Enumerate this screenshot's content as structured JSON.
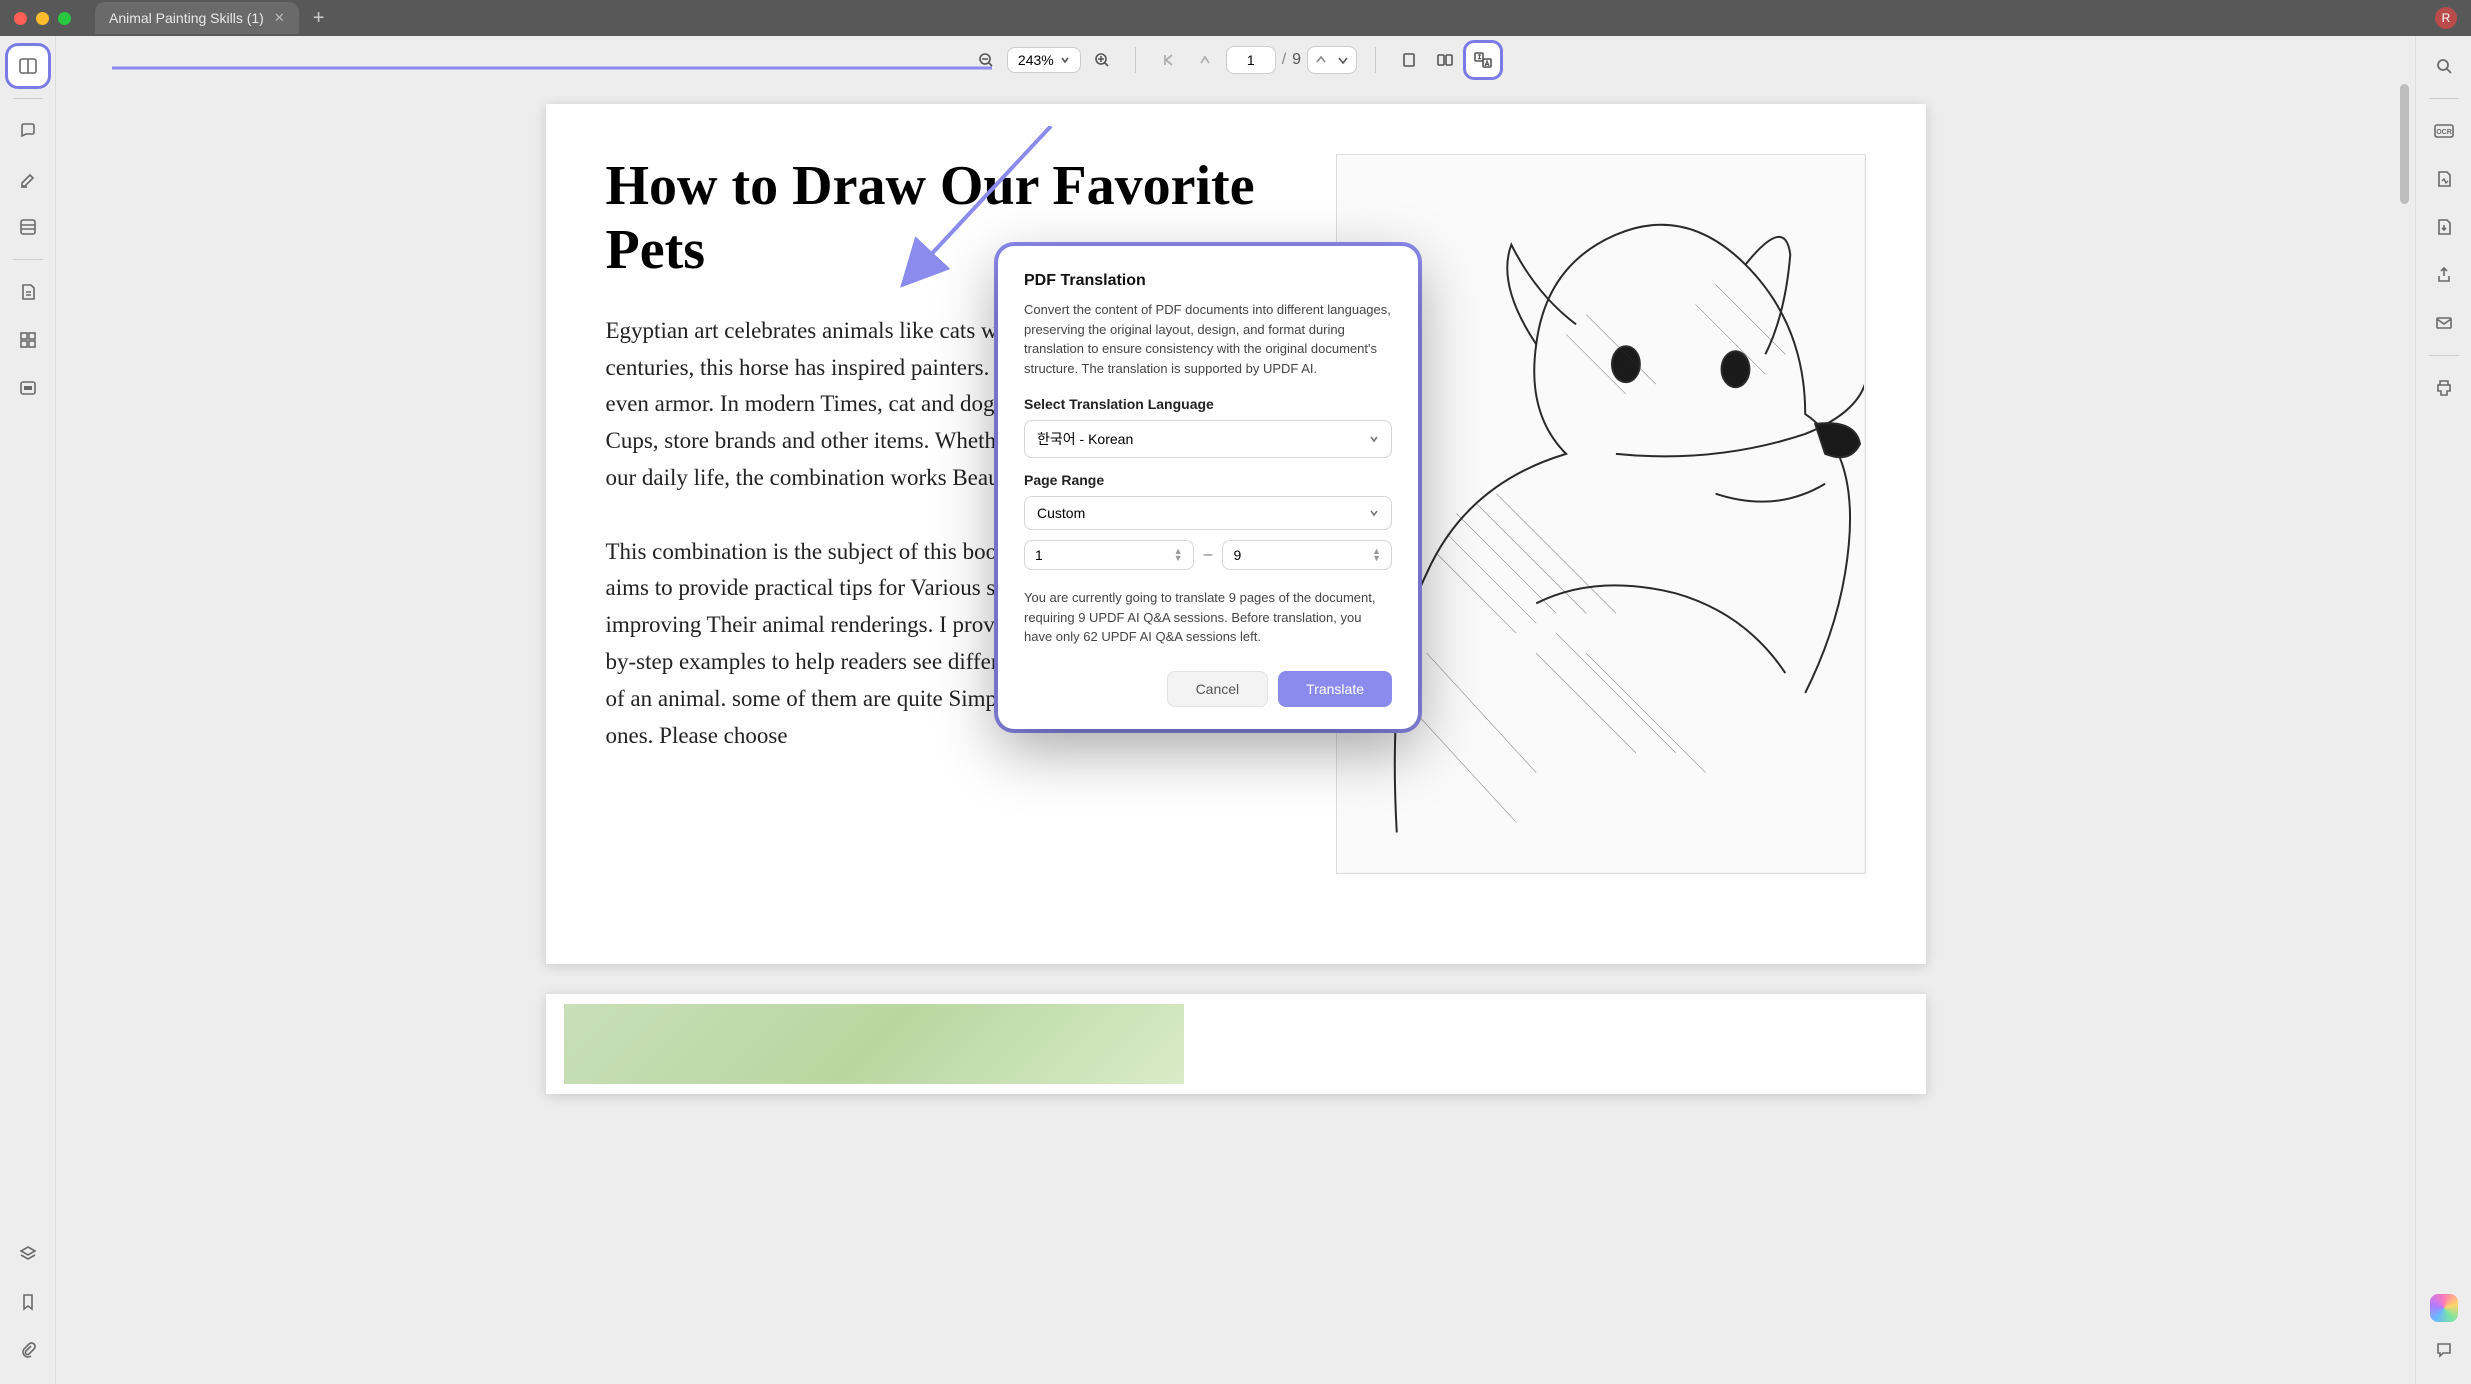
{
  "titlebar": {
    "traffic": [
      "#ff5f57",
      "#febc2e",
      "#28c840"
    ],
    "tab_title": "Animal Painting Skills (1)",
    "avatar_letter": "R"
  },
  "toolbar": {
    "zoom": "243%",
    "page_current": "1",
    "page_total": "9"
  },
  "document": {
    "title": "How to Draw Our Favorite Pets",
    "body": "Egyptian art celebrates animals like cats with symbolic beauty. For centuries, this horse has inspired painters. Paintings, music, Jewelry, and even armor. In modern Times, cat and dog art sells a lot of t-shirts, mugs, Cups, store brands and other items. Whether or not Animals are a part of our daily life, the combination works Beautifully together.\n\nThis combination is the subject of this book. The Animal Drawing Guide aims to provide practical tips for Various skill levels, stepping stones for improving Their animal renderings. I provide many sketches and Step-by-step examples to help readers see different ways to Build the anatomy of an animal. some of them are quite Simple and others more advanced ones. Please choose"
  },
  "dialog": {
    "title": "PDF Translation",
    "description": "Convert the content of PDF documents into different languages, preserving the original layout, design, and format during translation to ensure consistency with the original document's structure. The translation is supported by UPDF AI.",
    "lang_label": "Select Translation Language",
    "lang_value": "한국어 - Korean",
    "range_label": "Page Range",
    "range_value": "Custom",
    "range_from": "1",
    "range_to": "9",
    "note": "You are currently going to translate 9 pages of the document, requiring 9 UPDF AI Q&A sessions. Before translation, you have only 62 UPDF AI Q&A sessions left.",
    "cancel": "Cancel",
    "translate": "Translate"
  }
}
